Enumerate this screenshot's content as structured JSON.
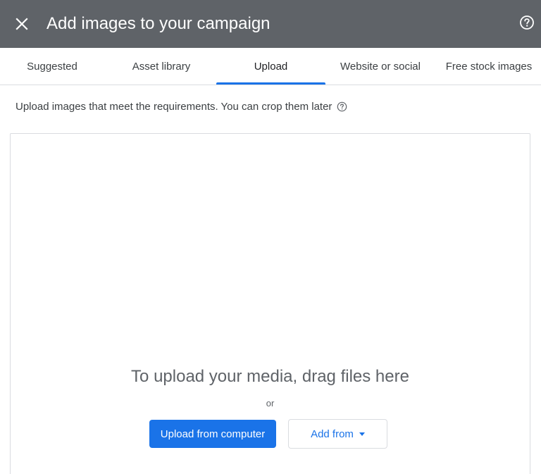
{
  "header": {
    "title": "Add images to your campaign",
    "close_icon": "close-icon",
    "help_icon": "help-circle-icon"
  },
  "tabs": [
    {
      "label": "Suggested",
      "active": false
    },
    {
      "label": "Asset library",
      "active": false
    },
    {
      "label": "Upload",
      "active": true
    },
    {
      "label": "Website or social",
      "active": false
    },
    {
      "label": "Free stock images",
      "active": false
    }
  ],
  "instruction": {
    "text": "Upload images that meet the requirements. You can crop them later",
    "help_icon": "help-circle-icon"
  },
  "dropzone": {
    "prompt": "To upload your media, drag files here",
    "or_text": "or",
    "upload_button": "Upload from computer",
    "add_from_button": "Add from",
    "add_from_icon": "caret-down-icon"
  },
  "colors": {
    "header_bg": "#5f6368",
    "accent": "#1a73e8",
    "border": "#dadce0",
    "text": "#3c4043"
  }
}
